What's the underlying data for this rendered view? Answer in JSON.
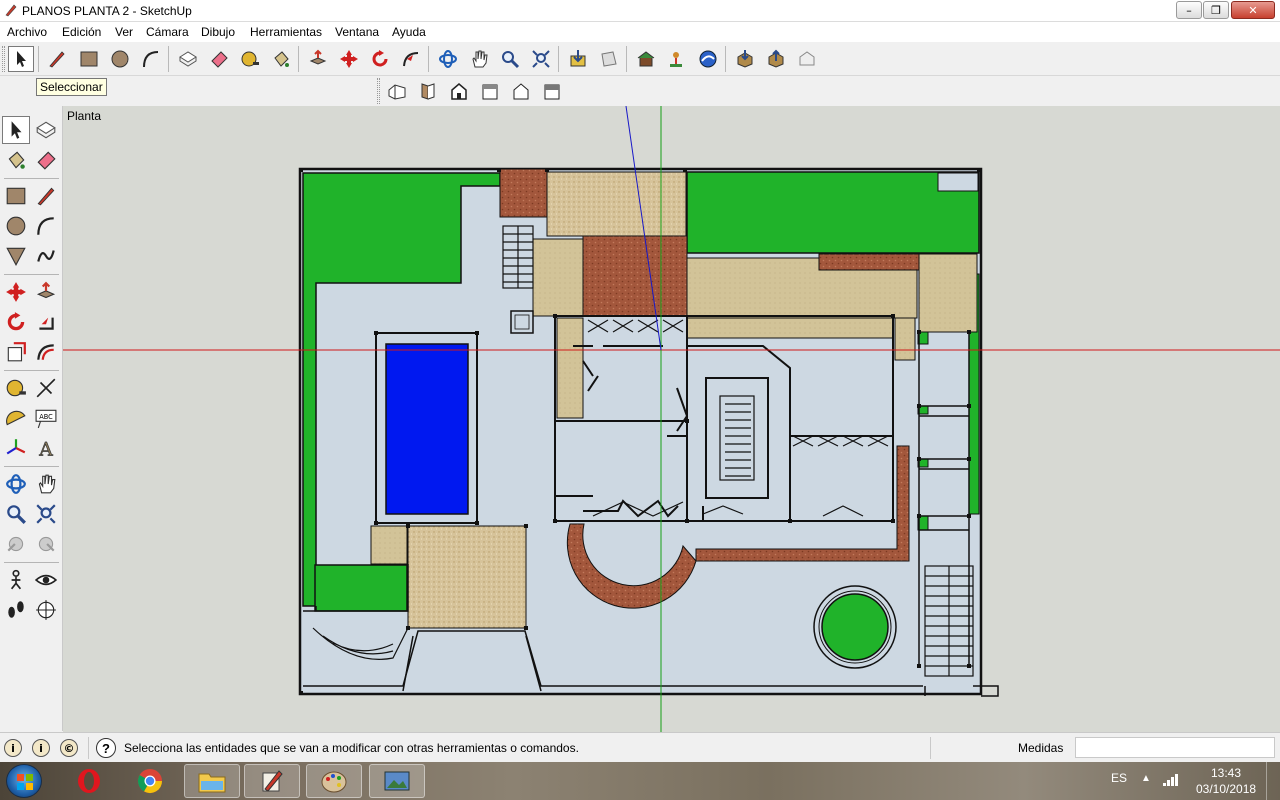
{
  "window": {
    "title": "PLANOS PLANTA 2 - SketchUp",
    "minimize": "–",
    "maximize": "❐",
    "close": "✕"
  },
  "menu": [
    "Archivo",
    "Edición",
    "Ver",
    "Cámara",
    "Dibujo",
    "Herramientas",
    "Ventana",
    "Ayuda"
  ],
  "tooltip": "Seleccionar",
  "viewport": {
    "scene_label": "Planta"
  },
  "status": {
    "message": "Selecciona las entidades que se van a modificar con otras herramientas o comandos.",
    "measurements_label": "Medidas",
    "measurements_value": ""
  },
  "taskbar": {
    "language": "ES",
    "time": "13:43",
    "date": "03/10/2018"
  },
  "colors": {
    "grass": "#20b32a",
    "pool": "#0018f0",
    "floor": "#cdd8e2",
    "brick": "#a3573c",
    "sand": "#cdbf92",
    "wood": "#d7c394",
    "background": "#d7d9d3"
  }
}
